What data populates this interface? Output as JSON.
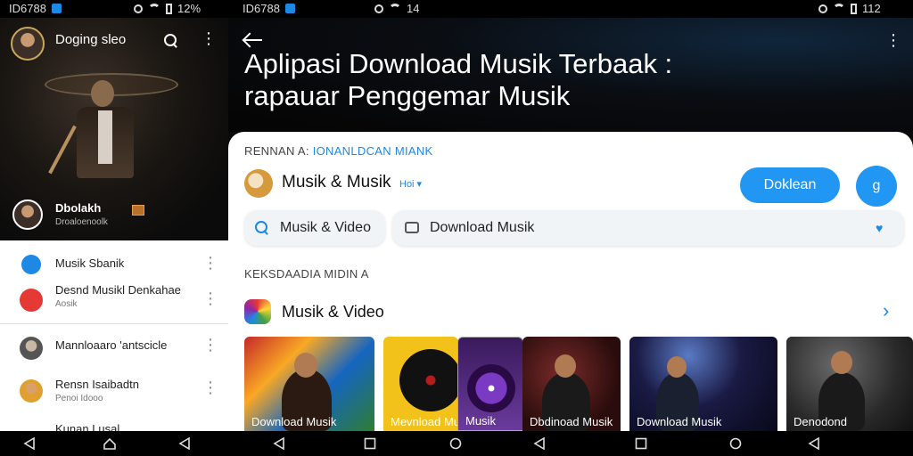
{
  "statusbar": {
    "left_id": "ID6788",
    "left_time": "12%",
    "center_id": "ID6788",
    "center_time": "14",
    "right_time": "112"
  },
  "left_panel": {
    "title": "Doging sleo",
    "user_name": "Dbolakh",
    "user_sub": "Droaloenoolk",
    "items": [
      {
        "title": "Musik Sbanik",
        "sub": ""
      },
      {
        "title": "Desnd Musikl Denkahae",
        "sub": "Aosik"
      },
      {
        "title": "Mannloaaro 'antscicle",
        "sub": ""
      },
      {
        "title": "Rensn Isaibadtn",
        "sub": "Penoi Idooo"
      },
      {
        "title": "Kunan Lusal",
        "sub": ""
      }
    ]
  },
  "right_panel": {
    "headline_line1": "Aplipasi Download Musik Terbaak :",
    "headline_line2": "rapauar Penggemar Musik",
    "section1_prefix": "RENNAN A:",
    "section1_highlight": "IONANLDCAN MIANK",
    "app_name": "Musik & Musik",
    "app_tag": "Hoi ▾",
    "download_button": "Doklean",
    "round_button": "g",
    "chips": [
      {
        "label": "Musik & Video",
        "icon": "search-icon"
      },
      {
        "label": "Download Musik",
        "icon": "chat-icon"
      }
    ],
    "section2": "KEKSDAADIA MIDIN A",
    "category": "Musik & Video",
    "thumbnails": [
      {
        "caption": "Download Musik"
      },
      {
        "caption": "Mevnload Musik"
      },
      {
        "caption": "Musik"
      },
      {
        "caption": "Dbdinoad Musik"
      },
      {
        "caption": "Download Musik"
      },
      {
        "caption": "Denodond"
      }
    ]
  },
  "colors": {
    "accent": "#2196f3",
    "link": "#1e88e5"
  }
}
